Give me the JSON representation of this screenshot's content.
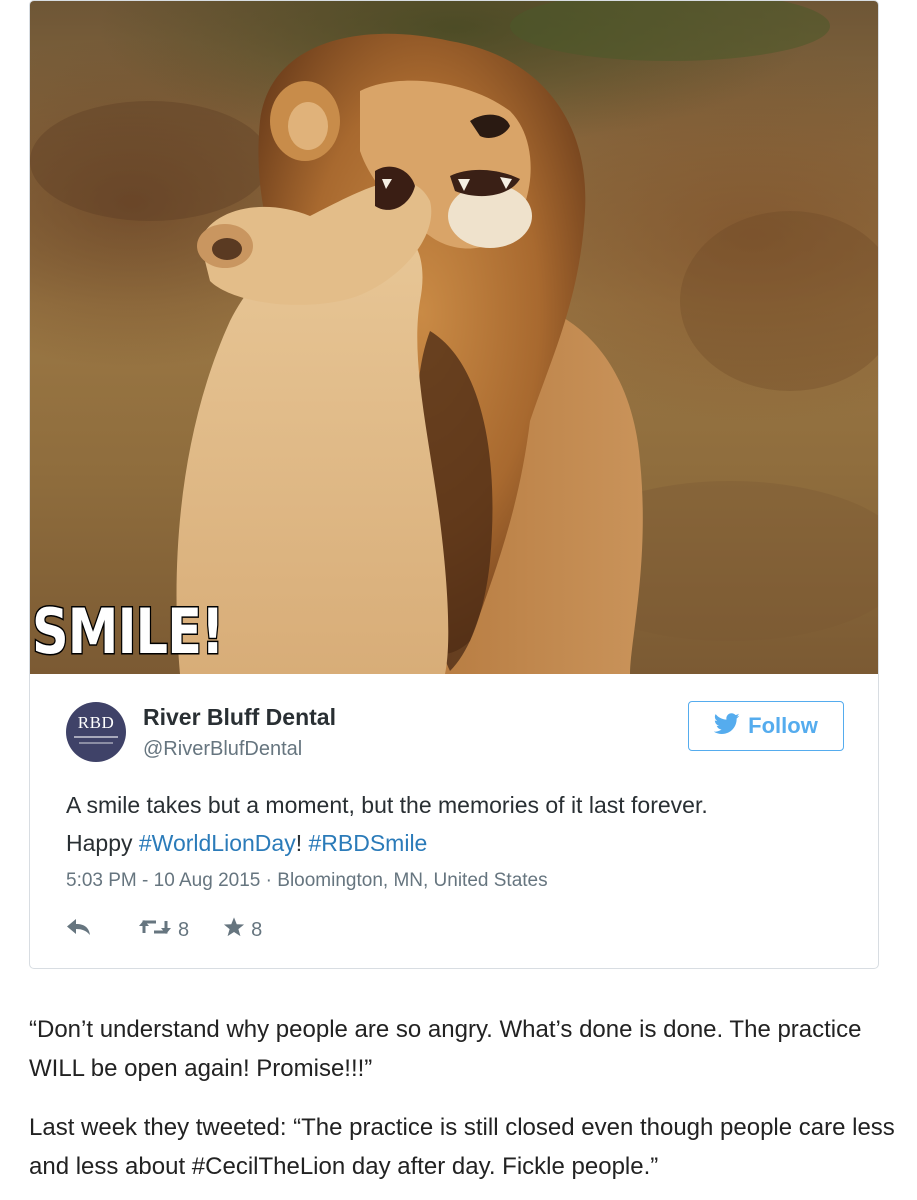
{
  "tweet": {
    "photo_caption": "SMILE!",
    "photo_alt": "lion-and-lioness-photo",
    "avatar_text": "RBD",
    "display_name": "River Bluff Dental",
    "handle": "@RiverBlufDental",
    "follow_label": "Follow",
    "text_line1": "A smile takes but a moment, but the memories of it last forever.",
    "text_happy": "Happy ",
    "hashtag1": "#WorldLionDay",
    "text_excl": "! ",
    "hashtag2": "#RBDSmile",
    "time": "5:03 PM - 10 Aug 2015",
    "separator": " · ",
    "location": "Bloomington, MN, United States",
    "retweet_count": "8",
    "favorite_count": "8",
    "colors": {
      "link": "#2b7bb9",
      "follow": "#55acee",
      "meta": "#66757f",
      "avatar_bg": "#3f4268"
    }
  },
  "article": {
    "paragraph1": "“Don’t understand why people are so angry. What’s done is done. The practice WILL be open again! Promise!!!”",
    "paragraph2": "Last week they tweeted: “The practice is still closed even though people care less and less about #CecilTheLion day after day. Fickle people.”"
  }
}
